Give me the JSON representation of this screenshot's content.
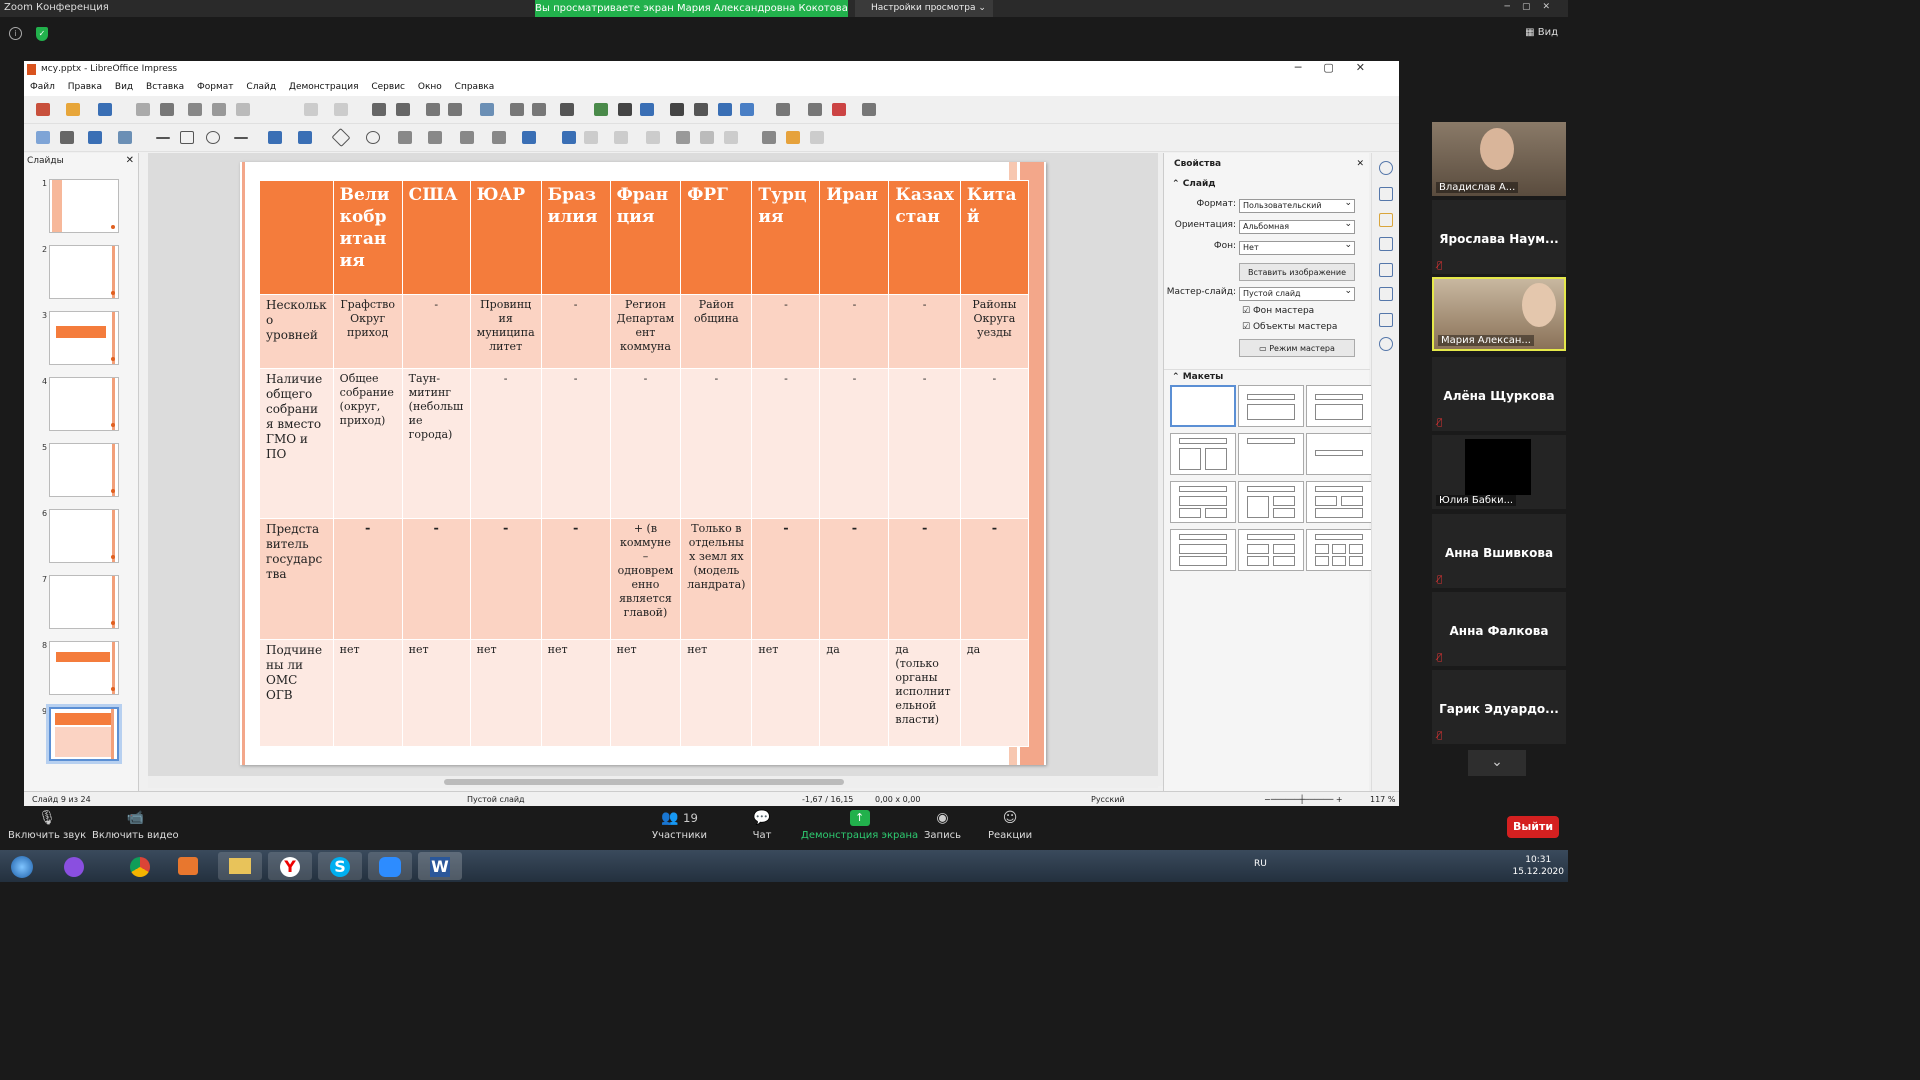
{
  "zoom": {
    "window_title": "Zoom Конференция",
    "share_banner": "Вы просматриваете экран Мария Александровна Кокотова",
    "view_options": "Настройки просмотра",
    "view_label": "Вид",
    "bottom": {
      "unmute": "Включить звук",
      "start_video": "Включить видео",
      "participants": "Участники",
      "participants_count": "19",
      "chat": "Чат",
      "share": "Демонстрация экрана",
      "record": "Запись",
      "reactions": "Реакции",
      "leave": "Выйти"
    },
    "participants": [
      {
        "name": "Владислав А...",
        "video": true
      },
      {
        "name": "Ярослава Наум...",
        "video": false
      },
      {
        "name": "Мария Алексан...",
        "video": true,
        "active": true
      },
      {
        "name": "Алёна Щуркова",
        "video": false
      },
      {
        "name": "Юлия Бабки...",
        "video": true
      },
      {
        "name": "Анна Вшивкова",
        "video": false
      },
      {
        "name": "Анна Фалкова",
        "video": false
      },
      {
        "name": "Гарик Эдуардо...",
        "video": false
      }
    ]
  },
  "lo": {
    "title": "мсу.pptx - LibreOffice Impress",
    "menu": [
      "Файл",
      "Правка",
      "Вид",
      "Вставка",
      "Формат",
      "Слайд",
      "Демонстрация",
      "Сервис",
      "Окно",
      "Справка"
    ],
    "slides_panel_title": "Слайды",
    "slide_numbers": [
      "1",
      "2",
      "3",
      "4",
      "5",
      "6",
      "7",
      "8",
      "9"
    ],
    "table": {
      "headers": [
        "",
        "Вели кобр итан ия",
        "США",
        "ЮАР",
        "Браз илия",
        "Фран ция",
        "ФРГ",
        "Турц ия",
        "Иран",
        "Казах стан",
        "Кита й"
      ],
      "rows": [
        [
          "Нескольк о уровней",
          "Графство Округ приход",
          "-",
          "Провинц ия муниципа литет",
          "-",
          "Регион Департам ент коммуна",
          "Район община",
          "-",
          "-",
          "-",
          "Районы Округа уезды"
        ],
        [
          "Наличие общего собрани я вместо ГМО и ПО",
          "Общее собрание (округ, приход)",
          "Таун-митинг (небольш ие города)",
          "-",
          "-",
          "-",
          "-",
          "-",
          "-",
          "-",
          "-"
        ],
        [
          "Предста витель государс тва",
          "-",
          "-",
          "-",
          "-",
          "+ (в коммуне – одноврем енно является главой)",
          "Только в отдельны х земл ях (модель ландрата)",
          "-",
          "-",
          "-",
          "-"
        ],
        [
          "Подчине ны ли ОМС ОГВ",
          "нет",
          "нет",
          "нет",
          "нет",
          "нет",
          "нет",
          "нет",
          "да",
          "да (только органы исполнит ельной власти)",
          "да"
        ]
      ]
    },
    "properties": {
      "title": "Свойства",
      "section_slide": "Слайд",
      "format_label": "Формат:",
      "format_value": "Пользовательский",
      "orientation_label": "Ориентация:",
      "orientation_value": "Альбомная",
      "background_label": "Фон:",
      "background_value": "Нет",
      "insert_image": "Вставить изображение",
      "master_label": "Мастер-слайд:",
      "master_value": "Пустой слайд",
      "master_bg": "Фон мастера",
      "master_objects": "Объекты мастера",
      "master_mode": "Режим мастера",
      "section_layouts": "Макеты"
    },
    "status": {
      "slide": "Слайд 9 из 24",
      "layout": "Пустой слайд",
      "position": "-1,67 / 16,15",
      "size": "0,00 x 0,00",
      "language": "Русский",
      "zoom": "117 %"
    }
  },
  "taskbar": {
    "lang": "RU",
    "time": "10:31",
    "date": "15.12.2020"
  }
}
